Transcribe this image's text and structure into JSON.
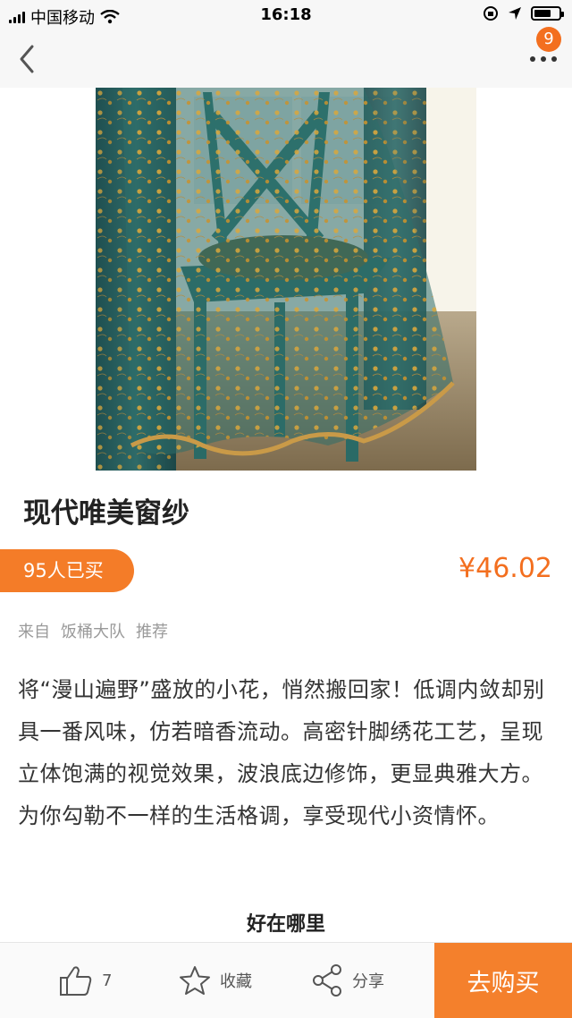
{
  "status": {
    "carrier": "中国移动",
    "time": "16:18"
  },
  "nav": {
    "badge_count": "9"
  },
  "product": {
    "title": "现代唯美窗纱",
    "buyers": "95人已买",
    "price": "¥46.02",
    "source": {
      "from": "来自",
      "group": "饭桶大队",
      "action": "推荐"
    },
    "description": "将“漫山遍野”盛放的小花，悄然搬回家！低调内敛却别具一番风味，仿若暗香流动。高密针脚绣花工艺，呈现立体饱满的视觉效果，波浪底边修饰，更显典雅大方。为你勾勒不一样的生活格调，享受现代小资情怀。",
    "section_heading": "好在哪里"
  },
  "toolbar": {
    "like_count": "7",
    "collect_label": "收藏",
    "share_label": "分享",
    "buy_label": "去购买"
  },
  "colors": {
    "accent": "#f47c28"
  },
  "icons": [
    "back-icon",
    "more-icon",
    "thumb-up-icon",
    "star-icon",
    "share-icon",
    "wifi-icon",
    "location-icon"
  ]
}
